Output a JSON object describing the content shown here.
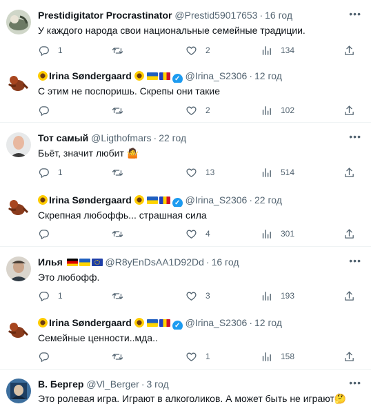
{
  "tweets": [
    {
      "name": "Prestidigitator Procrastinator",
      "handle": "@Prestid59017653",
      "time": "16 год",
      "text": "У каждого народа свои национальные семейные традиции.",
      "reply_count": "1",
      "retweet_count": "",
      "like_count": "2",
      "view_count": "134"
    },
    {
      "name": "Irina Søndergaard",
      "handle": "@Irina_S2306",
      "time": "12 год",
      "text": "С этим не поспоришь. Скрепы они такие",
      "reply_count": "",
      "retweet_count": "",
      "like_count": "2",
      "view_count": "102"
    },
    {
      "name": "Тот самый",
      "handle": "@Ligthofmars",
      "time": "22 год",
      "text": "Бьёт, значит любит",
      "reply_count": "1",
      "retweet_count": "",
      "like_count": "13",
      "view_count": "514"
    },
    {
      "name": "Irina Søndergaard",
      "handle": "@Irina_S2306",
      "time": "22 год",
      "text": "Скрепная любоффь... страшная сила",
      "reply_count": "",
      "retweet_count": "",
      "like_count": "4",
      "view_count": "301"
    },
    {
      "name": "Илья",
      "handle": "@R8yEnDsAA1D92Dd",
      "time": "16 год",
      "text": "Это любофф.",
      "reply_count": "1",
      "retweet_count": "",
      "like_count": "3",
      "view_count": "193"
    },
    {
      "name": "Irina Søndergaard",
      "handle": "@Irina_S2306",
      "time": "12 год",
      "text": "Семейные ценности..мда..",
      "reply_count": "",
      "retweet_count": "",
      "like_count": "1",
      "view_count": "158"
    },
    {
      "name": "В. Бергер",
      "handle": "@Vl_Berger",
      "time": "3 год",
      "text": "Это ролевая игра. Играют в алкоголиков. А может быть не играют"
    }
  ],
  "icons": {
    "reply": "speech-bubble-icon",
    "retweet": "retweet-icon",
    "like": "heart-icon",
    "views": "bar-chart-icon",
    "share": "share-upload-icon",
    "more": "more-horizontal-icon",
    "verified": "verified-badge-icon"
  },
  "colors": {
    "text": "#0f1419",
    "secondary": "#536471",
    "verified": "#1d9bf0",
    "divider": "#eff3f4"
  }
}
